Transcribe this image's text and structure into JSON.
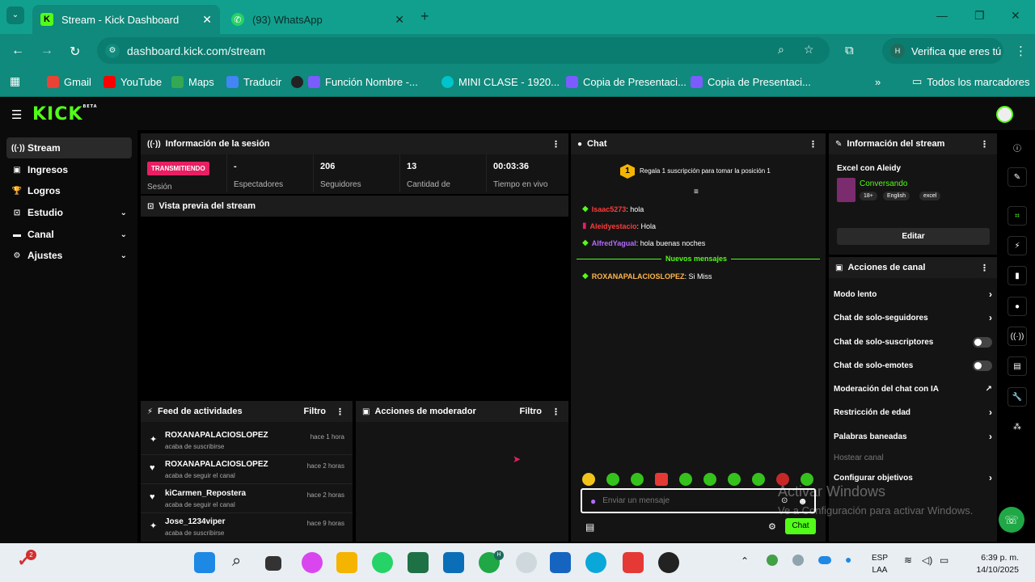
{
  "browser": {
    "tabs": [
      {
        "title": "Stream - Kick Dashboard",
        "icon": "kick-icon"
      },
      {
        "title": "(93) WhatsApp",
        "icon": "whatsapp-icon"
      }
    ],
    "url": "dashboard.kick.com/stream",
    "profile_label": "Verifica que eres tú",
    "bookmarks": [
      "Gmail",
      "YouTube",
      "Maps",
      "Traducir",
      "Función Nombre -...",
      "MINI CLASE - 1920...",
      "Copia de Presentaci...",
      "Copia de Presentaci..."
    ],
    "all_bookmarks": "Todos los marcadores"
  },
  "kick": {
    "logo": "KICK",
    "beta": "BETA"
  },
  "sidebar": {
    "items": [
      {
        "label": "Stream",
        "icon": "signal-icon"
      },
      {
        "label": "Ingresos",
        "icon": "money-icon"
      },
      {
        "label": "Logros",
        "icon": "trophy-icon"
      },
      {
        "label": "Estudio",
        "icon": "studio-icon"
      },
      {
        "label": "Canal",
        "icon": "channel-icon"
      },
      {
        "label": "Ajustes",
        "icon": "gear-icon"
      }
    ]
  },
  "session": {
    "title": "Información de la sesión",
    "status": "TRANSMITIENDO",
    "status_label": "Sesión",
    "stats": [
      {
        "value": "-",
        "label": "Espectadores"
      },
      {
        "value": "206",
        "label": "Seguidores"
      },
      {
        "value": "13",
        "label": "Cantidad de"
      },
      {
        "value": "00:03:36",
        "label": "Tiempo en vivo"
      }
    ]
  },
  "preview": {
    "title": "Vista previa del stream"
  },
  "feed": {
    "title": "Feed de actividades",
    "filter": "Filtro",
    "items": [
      {
        "name": "ROXANAPALACIOSLOPEZ",
        "sub": "acaba de suscribirse",
        "time": "hace 1 hora"
      },
      {
        "name": "ROXANAPALACIOSLOPEZ",
        "sub": "acaba de seguir el canal",
        "time": "hace 2 horas"
      },
      {
        "name": "kiCarmen_Repostera",
        "sub": "acaba de seguir el canal",
        "time": "hace 2 horas"
      },
      {
        "name": "Jose_1234viper",
        "sub": "acaba de suscribirse",
        "time": "hace 9 horas"
      }
    ]
  },
  "mod": {
    "title": "Acciones de moderador",
    "filter": "Filtro"
  },
  "chat": {
    "title": "Chat",
    "gift_rank": "1",
    "gift_text": "Regala 1 suscripción para tomar la posición 1",
    "messages": [
      {
        "user": "Isaac5273",
        "text": ": hola",
        "color": "#ff3b3b"
      },
      {
        "user": "Aleidyestacio",
        "text": ": Hola",
        "color": "#ff3b3b"
      },
      {
        "user": "AlfredYagual",
        "text": ": hola buenas noches",
        "color": "#b36bff"
      }
    ],
    "new_messages": "Nuevos mensajes",
    "new": [
      {
        "user": "ROXANAPALACIOSLOPEZ",
        "text": ": Si Miss",
        "color": "#ffb74a"
      }
    ],
    "placeholder": "Enviar un mensaje",
    "send": "Chat"
  },
  "stream_info": {
    "title": "Información del stream",
    "stream_title": "Excel con Aleidy",
    "category": "Conversando",
    "tags": [
      "18+",
      "English",
      "excel"
    ],
    "edit": "Editar"
  },
  "channel_actions": {
    "title": "Acciones de canal",
    "items": [
      {
        "label": "Modo lento",
        "ctrl": "chevron"
      },
      {
        "label": "Chat de solo-seguidores",
        "ctrl": "chevron"
      },
      {
        "label": "Chat de solo-suscriptores",
        "ctrl": "toggle"
      },
      {
        "label": "Chat de solo-emotes",
        "ctrl": "toggle"
      },
      {
        "label": "Moderación del chat con IA",
        "ctrl": "external"
      },
      {
        "label": "Restricción de edad",
        "ctrl": "chevron"
      },
      {
        "label": "Palabras baneadas",
        "ctrl": "chevron"
      },
      {
        "label": "Hostear canal",
        "ctrl": "none"
      },
      {
        "label": "Configurar objetivos",
        "ctrl": "chevron"
      }
    ]
  },
  "watermark": {
    "line1": "Activar Windows",
    "line2": "Ve a Configuración para activar Windows."
  },
  "taskbar": {
    "notif_count": "2",
    "lang1": "ESP",
    "lang2": "LAA",
    "time": "6:39 p. m.",
    "date": "14/10/2025",
    "badge": "H"
  },
  "colors": {
    "accent": "#53fc18",
    "browser": "#0f8a7c",
    "live": "#e91e63"
  }
}
